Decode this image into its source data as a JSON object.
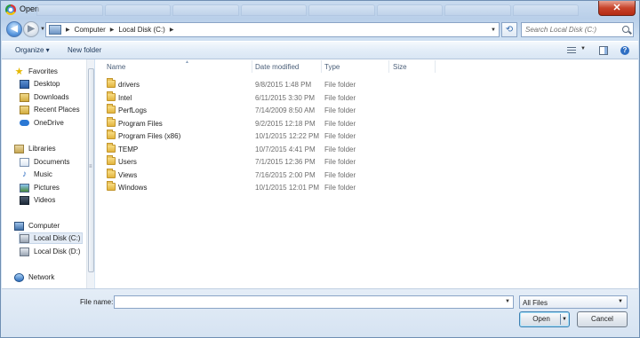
{
  "window": {
    "title": "Open",
    "close_glyph": "✕"
  },
  "nav": {
    "back_glyph": "◀",
    "forward_glyph": "▶"
  },
  "address": {
    "crumbs": [
      "Computer",
      "Local Disk (C:)"
    ]
  },
  "search": {
    "placeholder": "Search Local Disk (C:)"
  },
  "toolbar": {
    "organize_label": "Organize ▾",
    "new_folder_label": "New folder",
    "help_glyph": "?"
  },
  "sidebar": {
    "favorites": {
      "label": "Favorites",
      "items": [
        "Desktop",
        "Downloads",
        "Recent Places",
        "OneDrive"
      ]
    },
    "libraries": {
      "label": "Libraries",
      "items": [
        "Documents",
        "Music",
        "Pictures",
        "Videos"
      ]
    },
    "computer": {
      "label": "Computer",
      "items": [
        "Local Disk (C:)",
        "Local Disk (D:)"
      ]
    },
    "network": {
      "label": "Network"
    }
  },
  "file_list": {
    "columns": [
      "Name",
      "Date modified",
      "Type",
      "Size"
    ],
    "rows": [
      {
        "name": "drivers",
        "date": "9/8/2015 1:48 PM",
        "type": "File folder"
      },
      {
        "name": "Intel",
        "date": "6/11/2015 3:30 PM",
        "type": "File folder"
      },
      {
        "name": "PerfLogs",
        "date": "7/14/2009 8:50 AM",
        "type": "File folder"
      },
      {
        "name": "Program Files",
        "date": "9/2/2015 12:18 PM",
        "type": "File folder"
      },
      {
        "name": "Program Files (x86)",
        "date": "10/1/2015 12:22 PM",
        "type": "File folder"
      },
      {
        "name": "TEMP",
        "date": "10/7/2015 4:41 PM",
        "type": "File folder"
      },
      {
        "name": "Users",
        "date": "7/1/2015 12:36 PM",
        "type": "File folder"
      },
      {
        "name": "Views",
        "date": "7/16/2015 2:00 PM",
        "type": "File folder"
      },
      {
        "name": "Windows",
        "date": "10/1/2015 12:01 PM",
        "type": "File folder"
      }
    ]
  },
  "footer": {
    "file_name_label": "File name:",
    "file_name_value": "",
    "filter_value": "All Files",
    "open_label": "Open",
    "cancel_label": "Cancel"
  },
  "colors": {
    "accent": "#2e6ec3",
    "window_bg": "#d6e3f2",
    "close_red": "#c7432a"
  }
}
